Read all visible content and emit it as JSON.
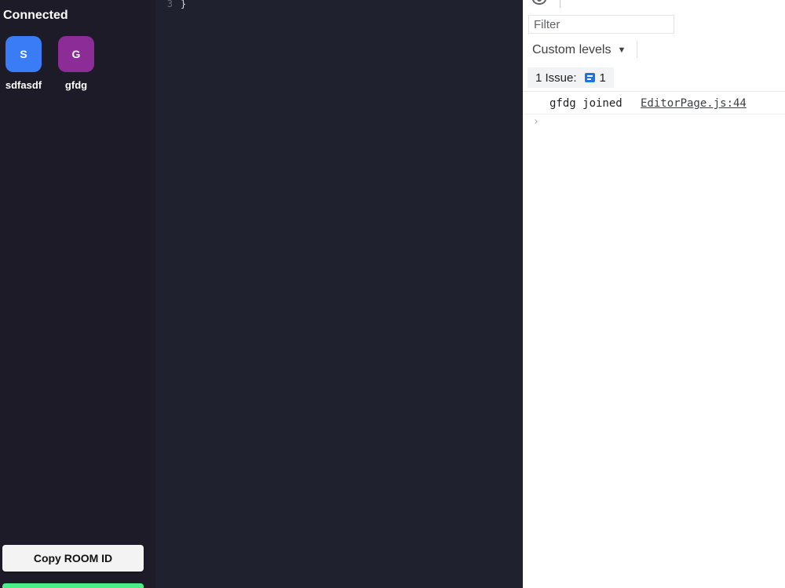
{
  "sidebar": {
    "title": "Connected",
    "clients": [
      {
        "initial": "S",
        "name": "sdfasdf",
        "color": "#3a7bf6"
      },
      {
        "initial": "G",
        "name": "gfdg",
        "color": "#8c2c96"
      }
    ],
    "copy_button_label": "Copy ROOM ID",
    "leave_button_color": "#4aed88"
  },
  "editor": {
    "line_number": "3",
    "line_text": "}"
  },
  "devtools": {
    "filter_placeholder": "Filter",
    "levels_label": "Custom levels",
    "issues_label": "1 Issue:",
    "issues_count": "1",
    "console_log": {
      "message": "gfdg joined",
      "source": "EditorPage.js:44"
    },
    "prompt_glyph": "›"
  },
  "colors": {
    "sidebar_bg": "#1c1b27",
    "editor_bg": "#20212e",
    "devtools_bg": "#ffffff",
    "issue_icon": "#1a73e8"
  }
}
